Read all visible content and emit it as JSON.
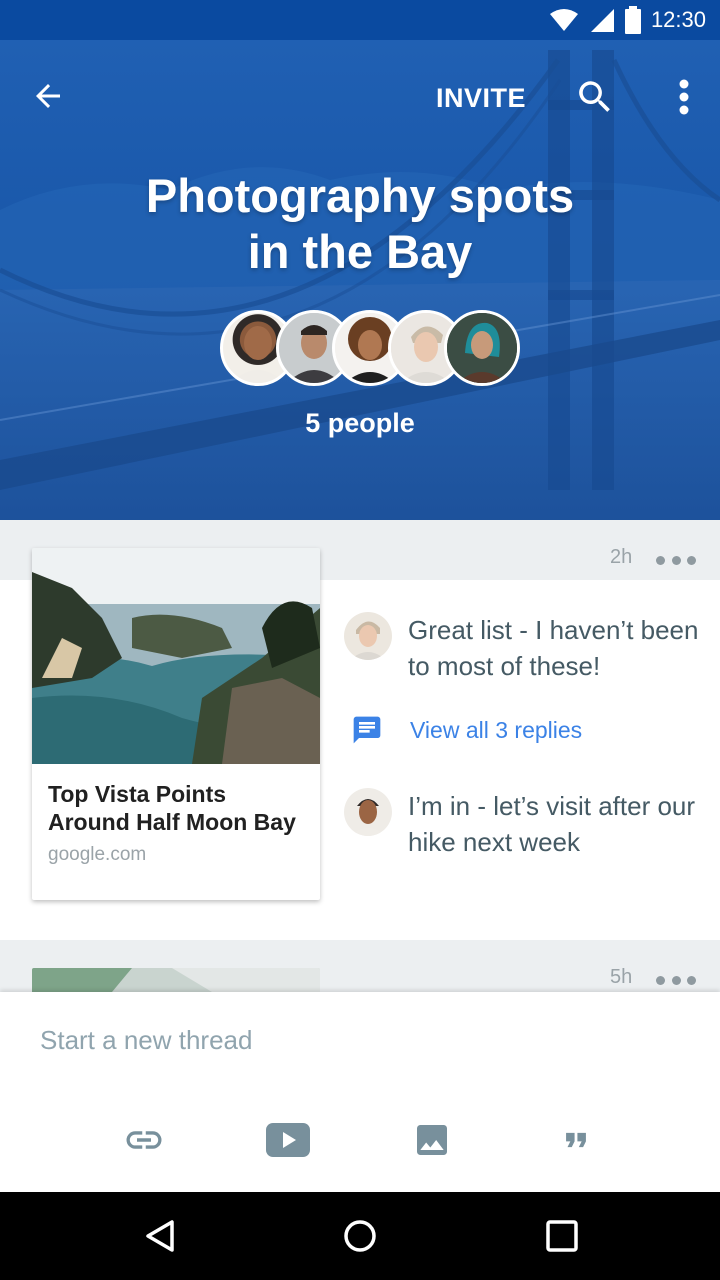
{
  "status_bar": {
    "time": "12:30",
    "icons": [
      "wifi-icon",
      "cell-signal-icon",
      "battery-icon"
    ]
  },
  "toolbar": {
    "back_icon": "arrow-back-icon",
    "invite_label": "INVITE",
    "search_icon": "search-icon",
    "more_icon": "more-vert-icon"
  },
  "header": {
    "title_line1": "Photography spots",
    "title_line2": "in the Bay",
    "people_count": "5 people",
    "background_image": "golden-gate-bridge"
  },
  "threads": [
    {
      "time": "2h",
      "link": {
        "title": "Top Vista Points Around Half Moon Bay",
        "source": "google.com"
      },
      "comments": [
        {
          "text": "Great list - I haven’t been to most of these!"
        },
        {
          "text": "I’m in - let’s visit after our hike next week"
        }
      ],
      "replies_label": "View all 3 replies"
    },
    {
      "time": "5h"
    }
  ],
  "composer": {
    "placeholder": "Start a new thread",
    "attachments": [
      "link-icon",
      "youtube-icon",
      "image-icon",
      "quote-icon"
    ]
  },
  "colors": {
    "header": "#1a58aa",
    "status_bar": "#0a4aa0",
    "accent": "#3b82e6",
    "text": "#455a64"
  }
}
